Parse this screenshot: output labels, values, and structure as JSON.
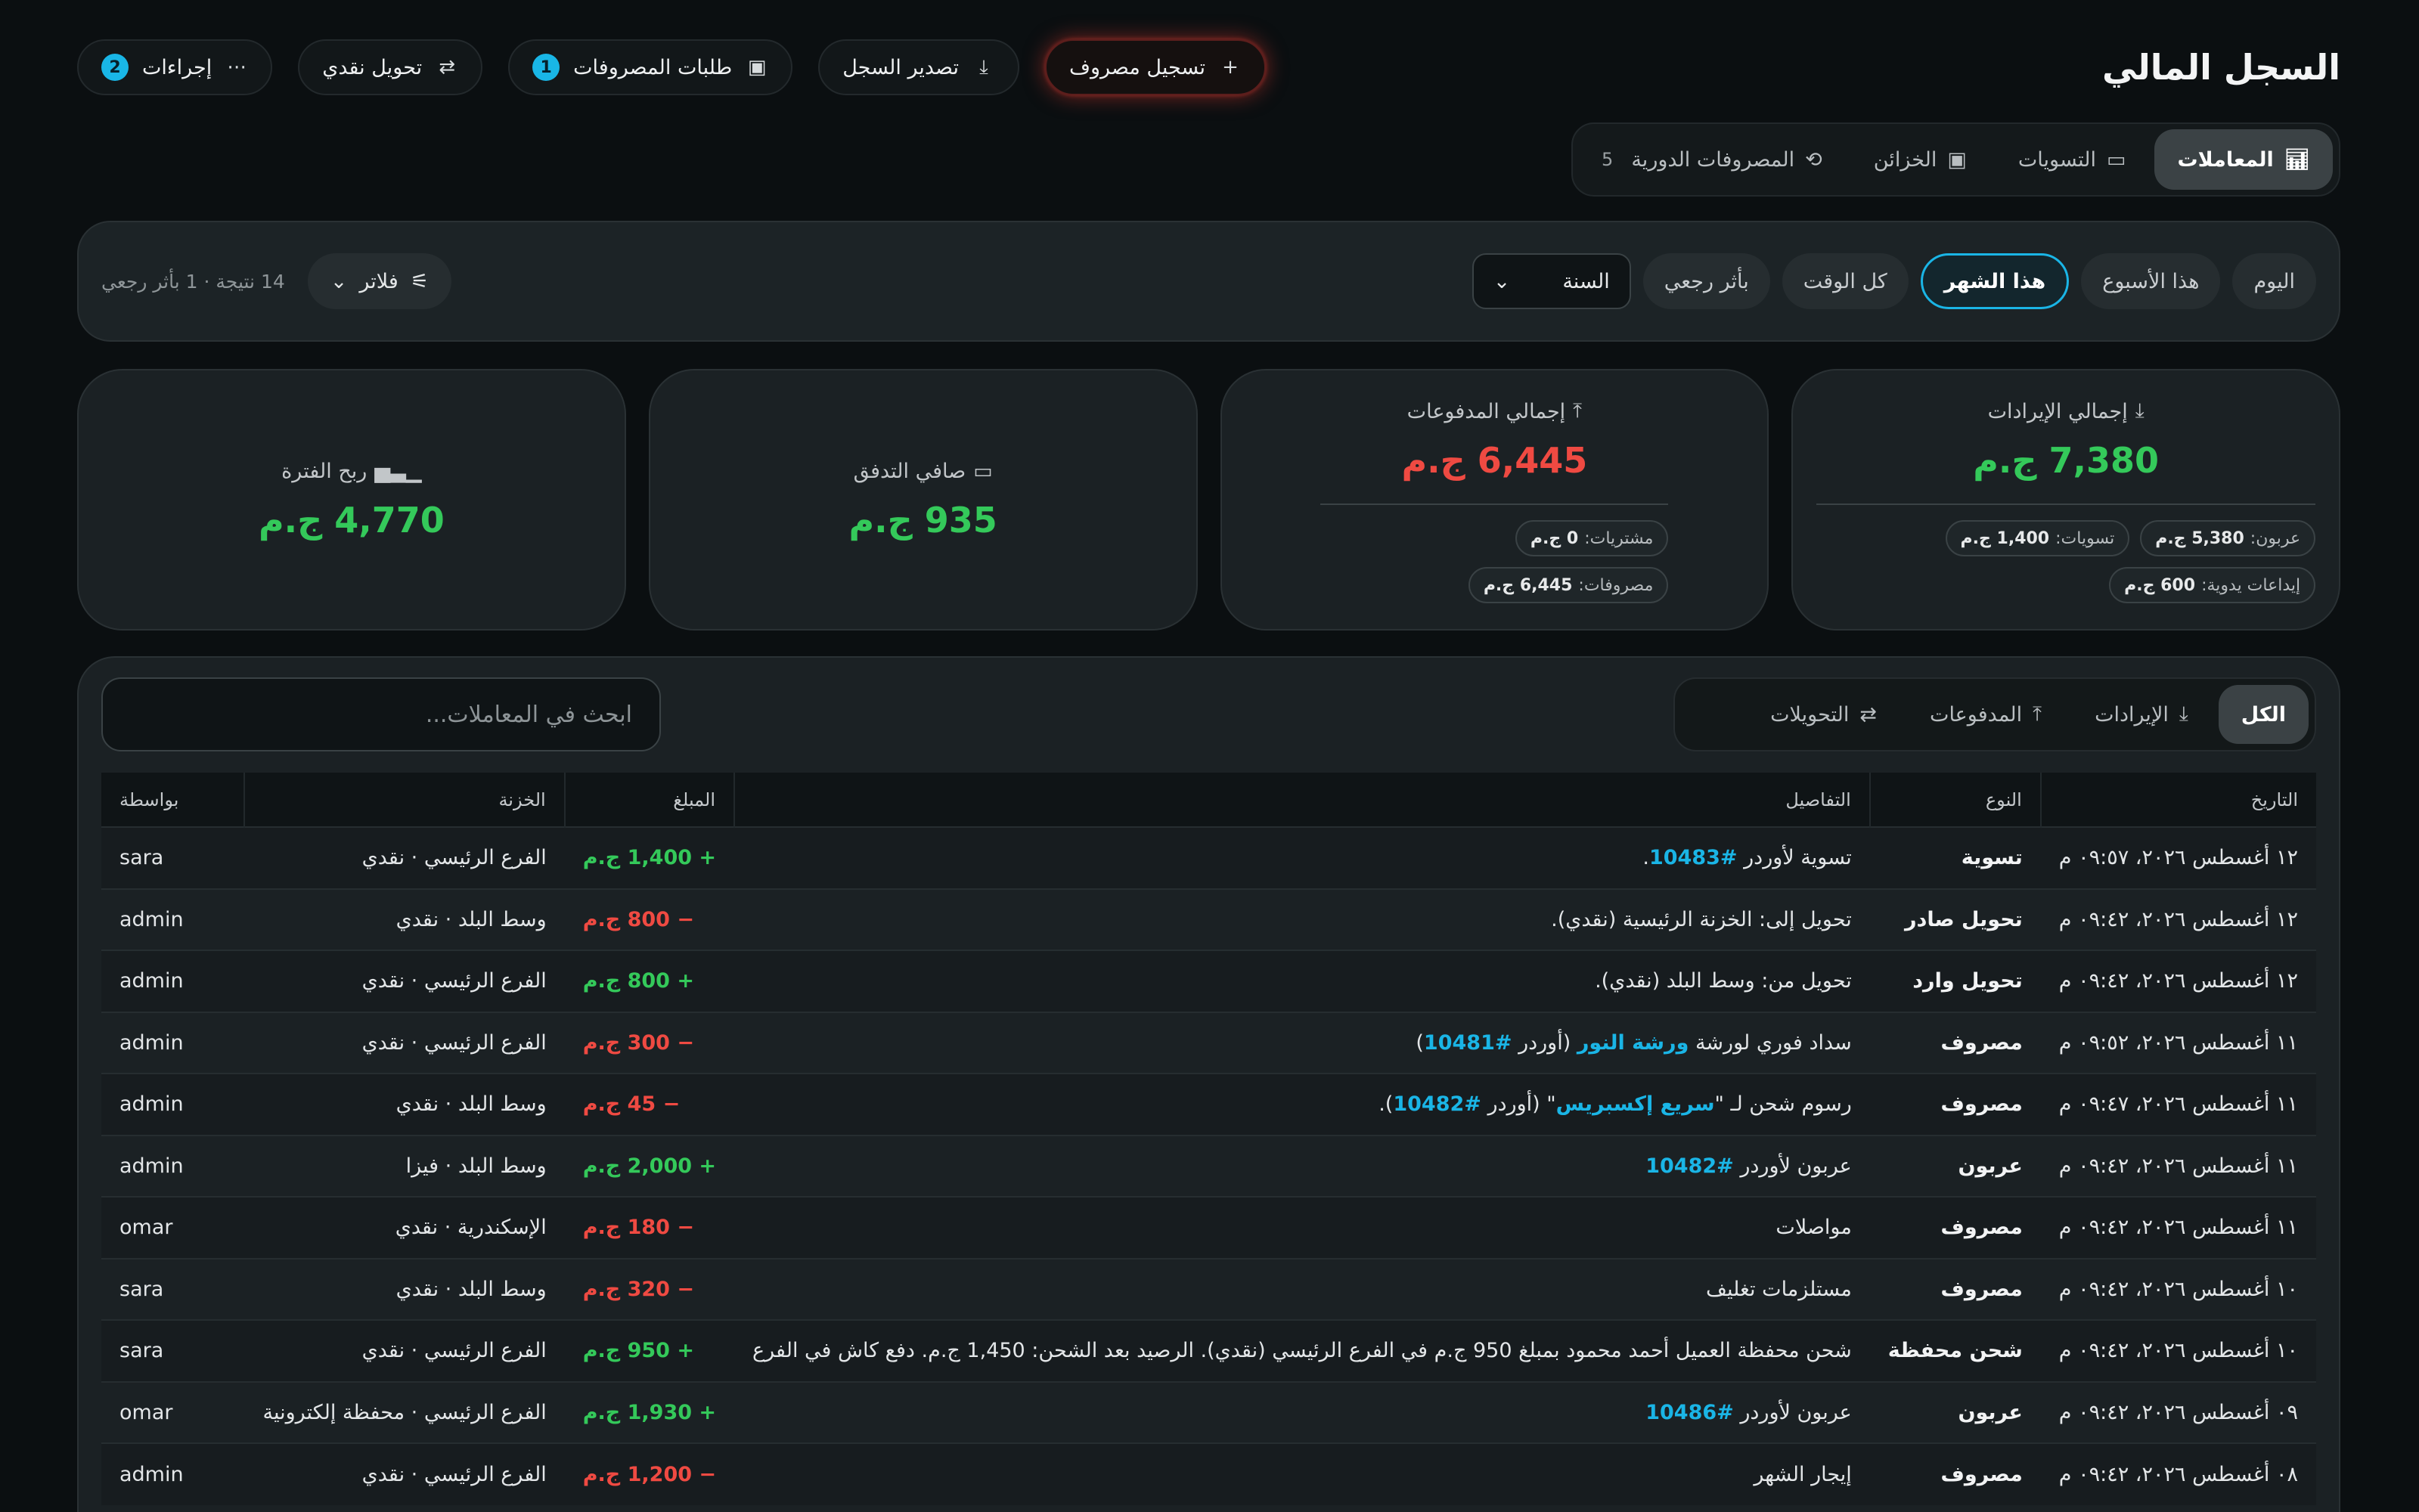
{
  "page": {
    "title": "السجل المالي"
  },
  "actions": [
    {
      "label": "إجراءات",
      "icon": "more-dots-icon",
      "badge": "2"
    },
    {
      "label": "تحويل نقدي",
      "icon": "swap-icon"
    },
    {
      "label": "طلبات المصروفات",
      "icon": "inbox-icon",
      "badge": "1"
    },
    {
      "label": "تصدير السجل",
      "icon": "download-icon"
    },
    {
      "label": "تسجيل مصروف",
      "icon": "plus-icon"
    }
  ],
  "main_tabs": [
    {
      "label": "المعاملات",
      "icon": "bar-chart-icon",
      "active": true
    },
    {
      "label": "التسويات",
      "icon": "wallet-icon"
    },
    {
      "label": "الخزائن",
      "icon": "inbox-icon"
    },
    {
      "label": "المصروفات الدورية",
      "icon": "repeat-icon",
      "count": "5"
    }
  ],
  "filters": {
    "periods": [
      "اليوم",
      "هذا الأسبوع",
      "هذا الشهر",
      "كل الوقت",
      "بأثر رجعي"
    ],
    "active_period": "هذا الشهر",
    "year_select": "السنة",
    "filter_label": "فلاتر",
    "results": "14 نتيجة · 1 بأثر رجعي"
  },
  "cards": {
    "income": {
      "label": "إجمالي الإيرادات",
      "value": "7,380 ج.م",
      "chips": [
        {
          "k": "عربون:",
          "v": "5,380 ج.م"
        },
        {
          "k": "تسويات:",
          "v": "1,400 ج.م"
        },
        {
          "k": "إيداعات يدوية:",
          "v": "600 ج.م"
        }
      ]
    },
    "payments": {
      "label": "إجمالي المدفوعات",
      "value": "6,445 ج.م",
      "chips": [
        {
          "k": "مشتريات:",
          "v": "0 ج.م"
        },
        {
          "k": "مصروفات:",
          "v": "6,445 ج.م"
        }
      ]
    },
    "netflow": {
      "label": "صافي التدفق",
      "value": "935 ج.م"
    },
    "profit": {
      "label": "ربح الفترة",
      "value": "4,770 ج.م"
    }
  },
  "table_tabs": [
    {
      "label": "الكل",
      "active": true
    },
    {
      "label": "الإيرادات",
      "icon": "download-icon"
    },
    {
      "label": "المدفوعات",
      "icon": "upload-icon"
    },
    {
      "label": "التحويلات",
      "icon": "swap-icon"
    }
  ],
  "search": {
    "placeholder": "ابحث في المعاملات..."
  },
  "columns": [
    "التاريخ",
    "النوع",
    "التفاصيل",
    "المبلغ",
    "الخزنة",
    "بواسطة"
  ],
  "rows": [
    {
      "date": "١٢ أغسطس ٢٠٢٦، ٠٩:٥٧ م",
      "type": "تسوية",
      "pre": "تسوية لأوردر ",
      "link": "#10483",
      "post": ".",
      "amount": "+ 1,400 ج.م",
      "sign": "pos",
      "vault": "الفرع الرئيسي · نقدي",
      "by": "sara"
    },
    {
      "date": "١٢ أغسطس ٢٠٢٦، ٠٩:٤٢ م",
      "type": "تحويل صادر",
      "pre": "تحويل إلى: الخزنة الرئيسية (نقدي).",
      "amount": "− 800 ج.م",
      "sign": "neg",
      "vault": "وسط البلد · نقدي",
      "by": "admin"
    },
    {
      "date": "١٢ أغسطس ٢٠٢٦، ٠٩:٤٢ م",
      "type": "تحويل وارد",
      "pre": "تحويل من: وسط البلد (نقدي).",
      "amount": "+ 800 ج.م",
      "sign": "pos",
      "vault": "الفرع الرئيسي · نقدي",
      "by": "admin"
    },
    {
      "date": "١١ أغسطس ٢٠٢٦، ٠٩:٥٢ م",
      "type": "مصروف",
      "pre": "سداد فوري لورشة ",
      "link": "ورشة النور",
      "mid": " (أوردر ",
      "link2": "#10481",
      "post": ")",
      "amount": "− 300 ج.م",
      "sign": "neg",
      "vault": "الفرع الرئيسي · نقدي",
      "by": "admin"
    },
    {
      "date": "١١ أغسطس ٢٠٢٦، ٠٩:٤٧ م",
      "type": "مصروف",
      "pre": "رسوم شحن لـ \"",
      "link": "سريع إكسبريس",
      "mid": "\" (أوردر ",
      "link2": "#10482",
      "post": ").",
      "amount": "− 45 ج.م",
      "sign": "neg",
      "vault": "وسط البلد · نقدي",
      "by": "admin"
    },
    {
      "date": "١١ أغسطس ٢٠٢٦، ٠٩:٤٢ م",
      "type": "عربون",
      "pre": "عربون لأوردر ",
      "link": "#10482",
      "amount": "+ 2,000 ج.م",
      "sign": "pos",
      "vault": "وسط البلد · فيزا",
      "by": "admin"
    },
    {
      "date": "١١ أغسطس ٢٠٢٦، ٠٩:٤٢ م",
      "type": "مصروف",
      "pre": "مواصلات",
      "amount": "− 180 ج.م",
      "sign": "neg",
      "vault": "الإسكندرية · نقدي",
      "by": "omar"
    },
    {
      "date": "١٠ أغسطس ٢٠٢٦، ٠٩:٤٢ م",
      "type": "مصروف",
      "pre": "مستلزمات تغليف",
      "amount": "− 320 ج.م",
      "sign": "neg",
      "vault": "وسط البلد · نقدي",
      "by": "sara"
    },
    {
      "date": "١٠ أغسطس ٢٠٢٦، ٠٩:٤٢ م",
      "type": "شحن محفظة",
      "pre": "شحن محفظة العميل أحمد محمود بمبلغ 950 ج.م في الفرع الرئيسي (نقدي). الرصيد بعد الشحن: 1,450 ج.م. دفع كاش في الفرع",
      "amount": "+ 950 ج.م",
      "sign": "pos",
      "vault": "الفرع الرئيسي · نقدي",
      "by": "sara"
    },
    {
      "date": "٠٩ أغسطس ٢٠٢٦، ٠٩:٤٢ م",
      "type": "عربون",
      "pre": "عربون لأوردر ",
      "link": "#10486",
      "amount": "+ 1,930 ج.م",
      "sign": "pos",
      "vault": "الفرع الرئيسي · محفظة إلكترونية",
      "by": "omar"
    },
    {
      "date": "٠٨ أغسطس ٢٠٢٦، ٠٩:٤٢ م",
      "type": "مصروف",
      "pre": "إيجار الشهر",
      "amount": "− 1,200 ج.م",
      "sign": "neg",
      "vault": "الفرع الرئيسي · نقدي",
      "by": "admin"
    }
  ],
  "colors": {
    "positive": "#34c95a",
    "negative": "#ef4a42",
    "accent": "#1ab5e6"
  }
}
